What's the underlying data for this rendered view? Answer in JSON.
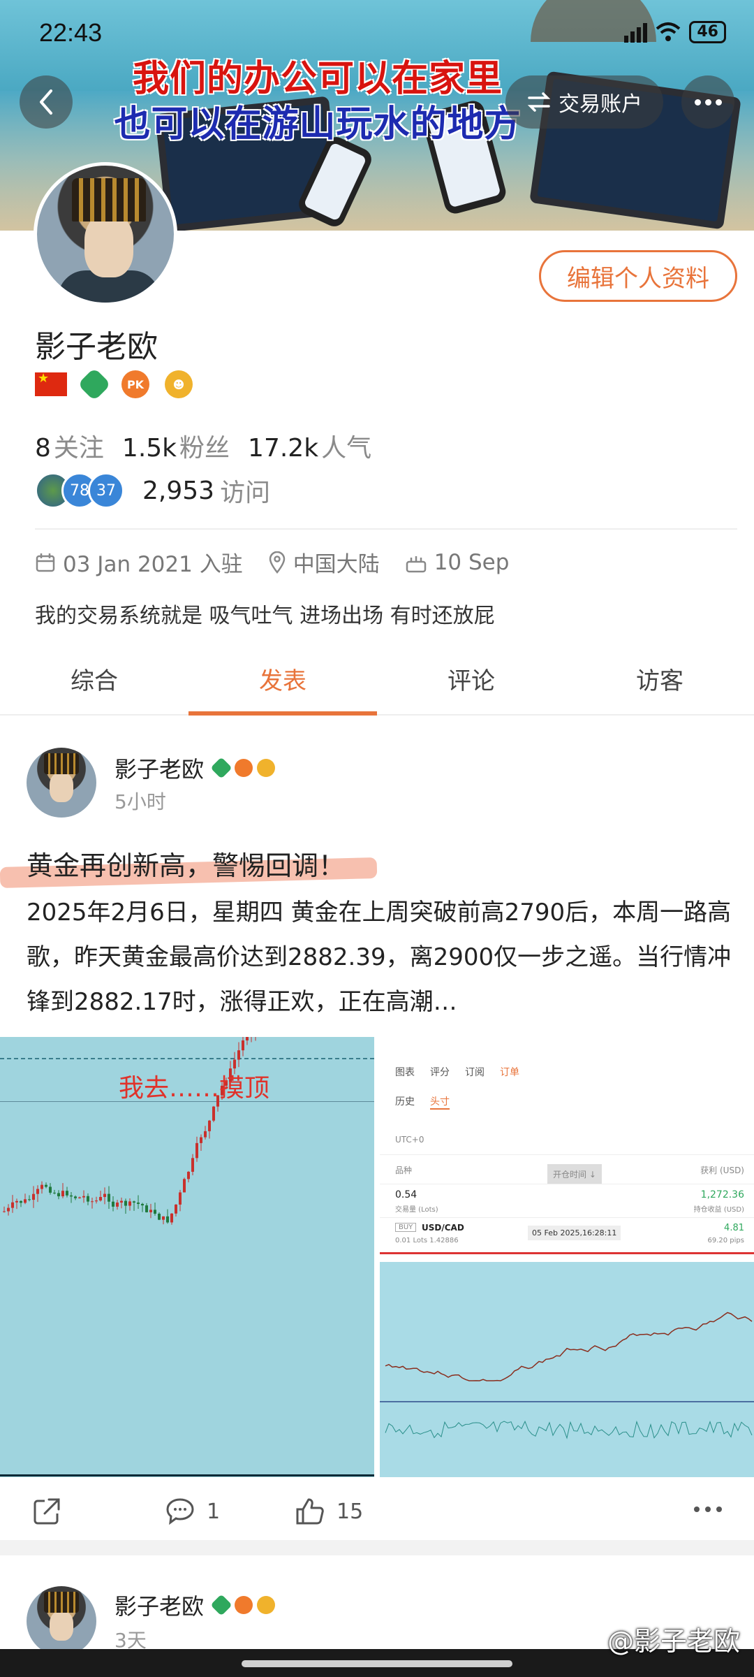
{
  "status_bar": {
    "time": "22:43",
    "battery": "46"
  },
  "header": {
    "banner_line1": "我们的办公可以在家里",
    "banner_line2": "也可以在游山玩水的地方",
    "account_button": "交易账户"
  },
  "profile": {
    "edit_button": "编辑个人资料",
    "username": "影子老欧",
    "stats": [
      {
        "value": "8",
        "label": "关注"
      },
      {
        "value": "1.5k",
        "label": "粉丝"
      },
      {
        "value": "17.2k",
        "label": "人气"
      }
    ],
    "visitor_badges": [
      "78",
      "37"
    ],
    "visits_value": "2,953",
    "visits_label": "访问",
    "joined": "03 Jan 2021 入驻",
    "location": "中国大陆",
    "birthday": "10 Sep",
    "bio": "我的交易系统就是 吸气吐气 进场出场 有时还放屁"
  },
  "tabs": [
    "综合",
    "发表",
    "评论",
    "访客"
  ],
  "post": {
    "author": "影子老欧",
    "time": "5小时",
    "title": "黄金再创新高，警惕回调！",
    "body": "2025年2月6日，星期四 黄金在上周突破前高2790后，本周一路高歌，昨天黄金最高价达到2882.39，离2900仅一步之遥。当行情冲锋到2882.17时，涨得正欢，正在高潮…",
    "image_left_caption": "我去……摸顶",
    "image_right": {
      "tabs": [
        "图表",
        "评分",
        "订阅",
        "订单"
      ],
      "subtabs": [
        "历史",
        "头寸"
      ],
      "tz": "UTC+0",
      "col_symbol": "品种",
      "col_open_time": "开仓时间 ↓",
      "col_profit": "获利 (USD)",
      "lots_value": "0.54",
      "lots_label": "交易量 (Lots)",
      "profit_total": "1,272.36",
      "profit_label": "持仓收益 (USD)",
      "side": "BUY",
      "symbol": "USD/CAD",
      "lots_line": "0.01 Lots 1.42886",
      "open_time": "05 Feb 2025,16:28:11",
      "profit": "4.81",
      "pips": "69.20 pips"
    },
    "comments": "1",
    "likes": "15"
  },
  "post2": {
    "author": "影子老欧",
    "time": "3天"
  },
  "watermark": "@影子老欧",
  "colors": {
    "accent": "#e8743b",
    "banner_red": "#d8140f",
    "banner_blue": "#1d2bb0"
  }
}
